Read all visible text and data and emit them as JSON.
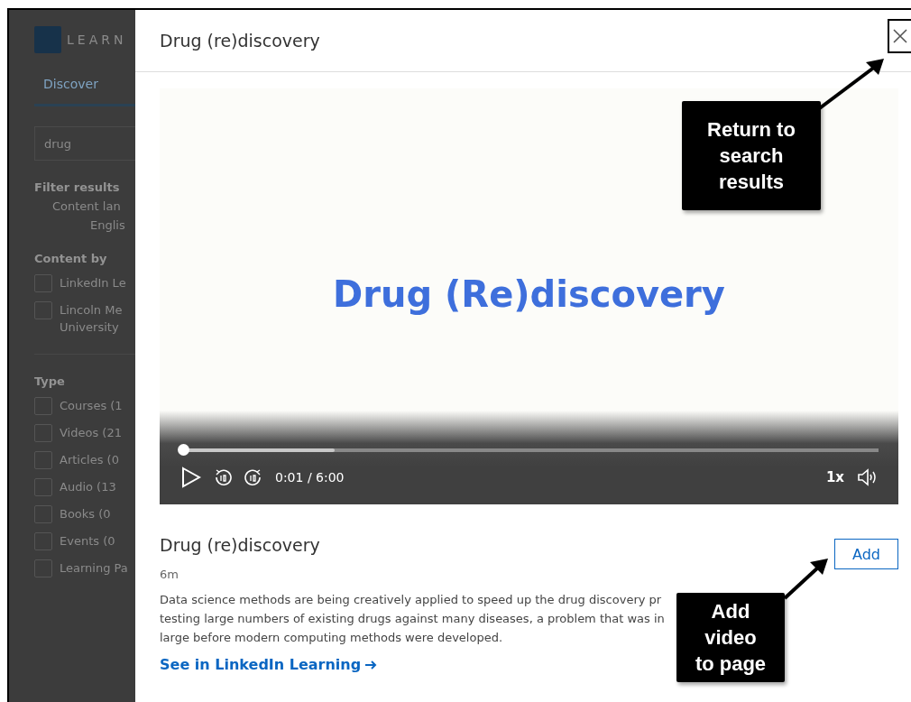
{
  "background_page": {
    "logo_text": "LEARN",
    "tab": "Discover",
    "search": {
      "value": "drug"
    },
    "filter_title": "Filter results",
    "language_label": "Content lan",
    "language_value": "Englis",
    "sections": [
      {
        "title": "Content by",
        "options": [
          {
            "label": "LinkedIn Le",
            "checked": false
          },
          {
            "label": "Lincoln Me University",
            "checked": false
          }
        ]
      },
      {
        "title": "Type",
        "options": [
          {
            "label": "Courses (1",
            "checked": false
          },
          {
            "label": "Videos (21",
            "checked": false
          },
          {
            "label": "Articles (0",
            "checked": false
          },
          {
            "label": "Audio (13",
            "checked": false
          },
          {
            "label": "Books (0",
            "checked": false
          },
          {
            "label": "Events (0",
            "checked": false
          },
          {
            "label": "Learning Pa",
            "checked": false
          }
        ]
      }
    ]
  },
  "modal": {
    "title": "Drug (re)discovery",
    "video": {
      "slide_title": "Drug (Re)discovery",
      "progress": {
        "level": 0.003
      },
      "time": "0:01 / 6:00",
      "speed": "1x"
    },
    "item": {
      "title": "Drug (re)discovery",
      "duration": "6m",
      "description_lines": [
        "Data science methods are being creatively applied to speed up the drug discovery pr",
        "testing large numbers of existing drugs against many diseases, a problem that was in",
        "large before modern computing methods were developed."
      ],
      "link": "See in LinkedIn Learning",
      "add_button": "Add"
    }
  },
  "callouts": [
    {
      "kind": "close",
      "text": "Return to search results"
    },
    {
      "kind": "add",
      "text": "Add video to page"
    }
  ]
}
